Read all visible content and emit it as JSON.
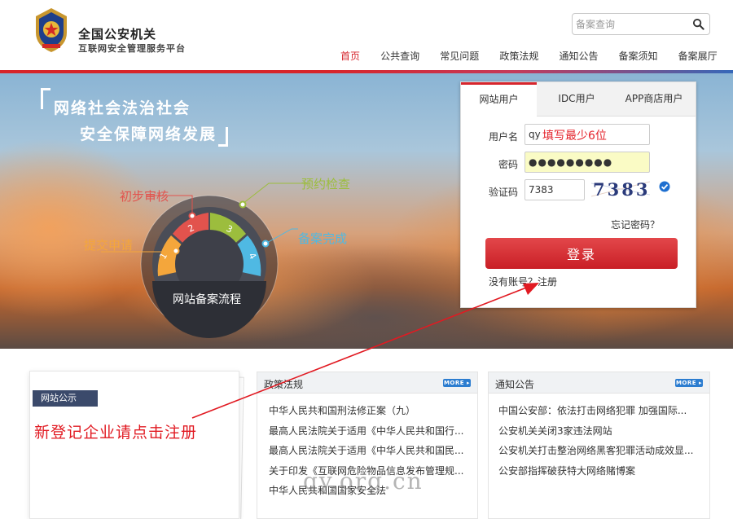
{
  "header": {
    "title": "全国公安机关",
    "subtitle": "互联网安全管理服务平台",
    "emblem_icon": "police-emblem-icon",
    "search": {
      "placeholder": "备案查询",
      "icon": "search-icon"
    }
  },
  "nav": {
    "items": [
      {
        "label": "首页",
        "active": true
      },
      {
        "label": "公共查询",
        "active": false
      },
      {
        "label": "常见问题",
        "active": false
      },
      {
        "label": "政策法规",
        "active": false
      },
      {
        "label": "通知公告",
        "active": false
      },
      {
        "label": "备案须知",
        "active": false
      },
      {
        "label": "备案展厅",
        "active": false
      }
    ]
  },
  "banner": {
    "slogan_line1": "网络社会法治社会",
    "slogan_line2": "安全保障网络发展",
    "flow": {
      "title": "网站备案流程",
      "steps": [
        {
          "number": "1",
          "label": "提交申请",
          "color": "#f4a63b"
        },
        {
          "number": "2",
          "label": "初步审核",
          "color": "#e2534d"
        },
        {
          "number": "3",
          "label": "预约检查",
          "color": "#9cbd3d"
        },
        {
          "number": "4",
          "label": "备案完成",
          "color": "#4fb9e3"
        }
      ]
    }
  },
  "login": {
    "tabs": [
      {
        "label": "网站用户",
        "active": true
      },
      {
        "label": "IDC用户",
        "active": false
      },
      {
        "label": "APP商店用户",
        "active": false
      }
    ],
    "username_label": "用户名",
    "username_value": "qy",
    "username_hint": "填写最少6位",
    "password_label": "密码",
    "password_value": "●●●●●●●●●",
    "captcha_label": "验证码",
    "captcha_value": "7383",
    "captcha_image_text": "7383",
    "forgot_link": "忘记密码？",
    "submit_label": "登录",
    "register_link": "没有账号？注册"
  },
  "notice": {
    "tag": "网站公示",
    "annotation": "新登记企业请点击注册"
  },
  "policy": {
    "title": "政策法规",
    "more": "MORE",
    "items": [
      "中华人民共和国刑法修正案（九）",
      "最高人民法院关于适用《中华人民共和国行...",
      "最高人民法院关于适用《中华人民共和国民...",
      "关于印发《互联网危险物品信息发布管理规...",
      "中华人民共和国国家安全法"
    ]
  },
  "notify": {
    "title": "通知公告",
    "more": "MORE",
    "items": [
      "中国公安部：依法打击网络犯罪 加强国际...",
      "公安机关关闭3家违法网站",
      "公安机关打击整治网络黑客犯罪活动成效显...",
      "公安部指挥破获特大网络赌博案"
    ]
  },
  "watermark": "qy.org.cn",
  "colors": {
    "brand_red": "#d6252c",
    "accent_blue": "#2c7dd0",
    "annotation_red": "#e11a22"
  }
}
